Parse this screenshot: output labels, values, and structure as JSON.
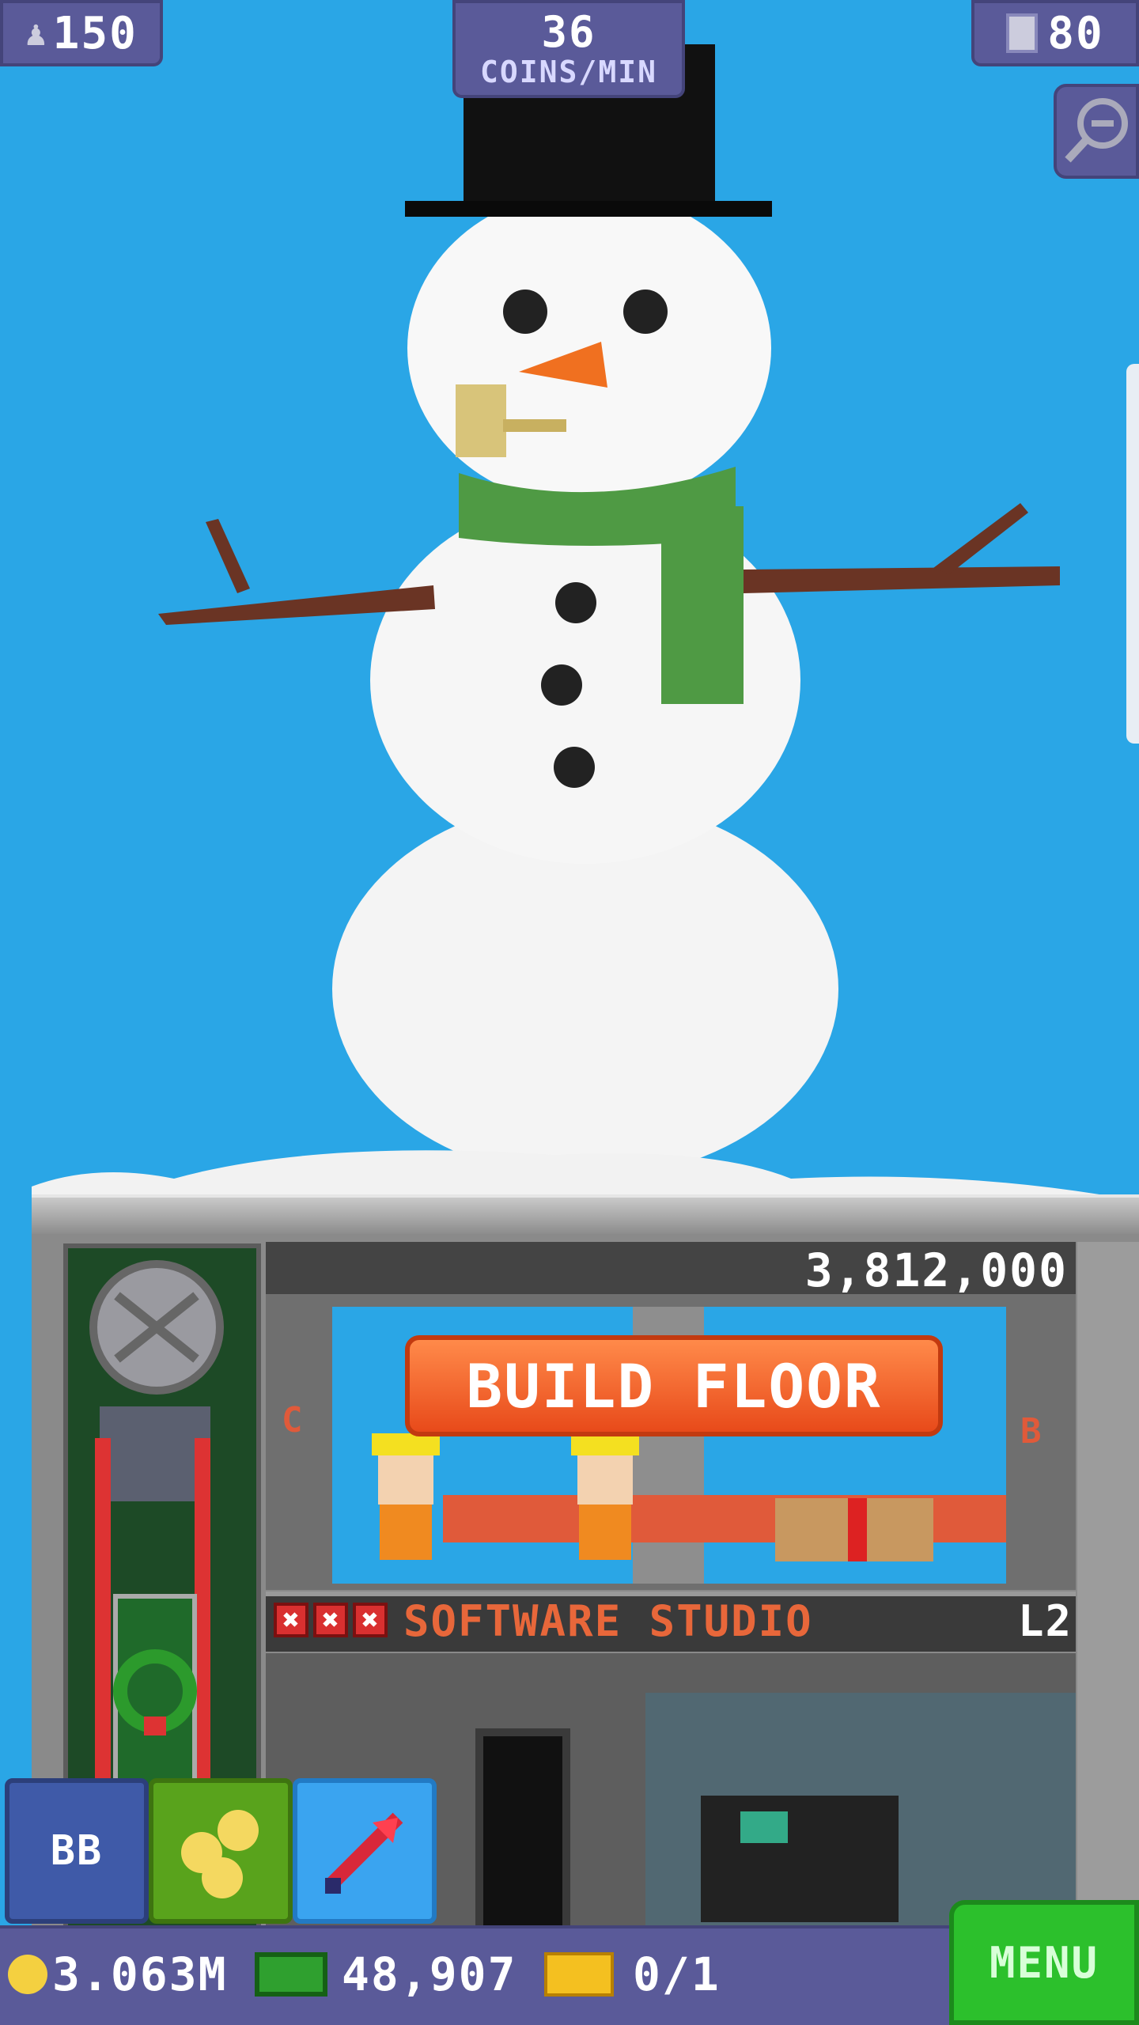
{
  "hud": {
    "population": "150",
    "rate_value": "36",
    "rate_label": "COINS/MIN",
    "floors": "80"
  },
  "floor_build": {
    "cost": "3,812,000",
    "button_label": "BUILD FLOOR",
    "left_letter": "C",
    "right_letter": "B"
  },
  "floor_software": {
    "name": "SOFTWARE STUDIO",
    "level": "L2"
  },
  "buttons": {
    "bb_label": "BB",
    "menu_label": "MENU"
  },
  "currency": {
    "coins": "3.063M",
    "bux": "48,907",
    "tickets": "0/1"
  },
  "icons": [
    "person-icon",
    "building-icon",
    "zoom-out-icon",
    "coins-icon",
    "rocket-icon",
    "coin-icon",
    "bux-icon",
    "ticket-icon"
  ],
  "colors": {
    "sky": "#2aa6e6",
    "hud": "#5a5a99",
    "build_button": "#e84a1a",
    "menu": "#2cc02c",
    "floor_name": "#e8673a"
  }
}
